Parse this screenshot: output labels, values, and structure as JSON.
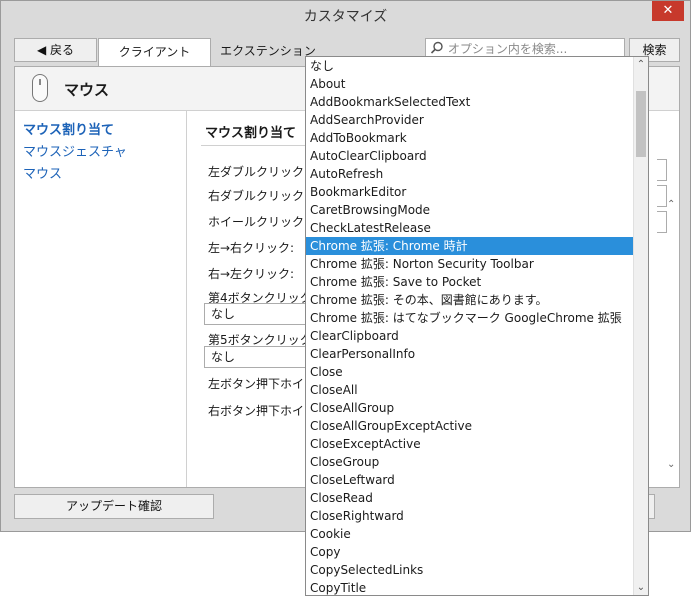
{
  "window": {
    "title": "カスタマイズ",
    "close_glyph": "✕"
  },
  "toolbar": {
    "back_label": "戻る",
    "back_icon": "◀",
    "tabs": [
      "クライアント",
      "エクステンション"
    ],
    "search_placeholder": "オプション内を検索...",
    "search_button": "検索"
  },
  "section": {
    "title": "マウス"
  },
  "sidebar": {
    "items": [
      "マウス割り当て",
      "マウスジェスチャ",
      "マウス"
    ]
  },
  "main": {
    "title": "マウス割り当て",
    "labels": [
      "左ダブルクリック:",
      "右ダブルクリック:",
      "ホイールクリック:",
      "左→右クリック:",
      "右→左クリック:",
      "第4ボタンクリック",
      "第5ボタンクリック",
      "左ボタン押下ホイー",
      "右ボタン押下ホイー"
    ],
    "field4_value": "なし",
    "field5_value": "なし"
  },
  "footer": {
    "update_button": "アップデート確認"
  },
  "dropdown": {
    "selected_index": 10,
    "items": [
      "なし",
      "About",
      "AddBookmarkSelectedText",
      "AddSearchProvider",
      "AddToBookmark",
      "AutoClearClipboard",
      "AutoRefresh",
      "BookmarkEditor",
      "CaretBrowsingMode",
      "CheckLatestRelease",
      "Chrome 拡張: Chrome 時計",
      "Chrome 拡張: Norton Security Toolbar",
      "Chrome 拡張: Save to Pocket",
      "Chrome 拡張: その本、図書館にあります。",
      "Chrome 拡張: はてなブックマーク GoogleChrome 拡張",
      "ClearClipboard",
      "ClearPersonalInfo",
      "Close",
      "CloseAll",
      "CloseAllGroup",
      "CloseAllGroupExceptActive",
      "CloseExceptActive",
      "CloseGroup",
      "CloseLeftward",
      "CloseRead",
      "CloseRightward",
      "Cookie",
      "Copy",
      "CopySelectedLinks",
      "CopyTitle"
    ]
  }
}
